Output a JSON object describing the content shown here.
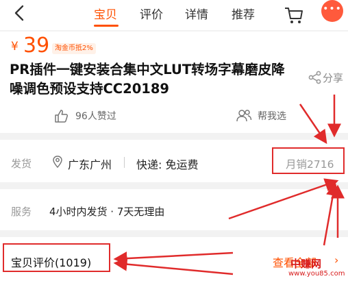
{
  "nav": {
    "tabs": [
      {
        "label": "宝贝",
        "active": true
      },
      {
        "label": "评价",
        "active": false
      },
      {
        "label": "详情",
        "active": false
      },
      {
        "label": "推荐",
        "active": false
      }
    ],
    "more_label": "•••",
    "icons": [
      "back-icon",
      "cart-icon"
    ]
  },
  "product": {
    "currency": "¥",
    "price": "39",
    "coin_badge": "淘金币抵2%",
    "title": "PR插件一键安装合集中文LUT转场字幕磨皮降噪调色预设支持CC20189",
    "share_label": "分享",
    "likes": "96人赞过",
    "help_choose": "帮我选"
  },
  "shipping": {
    "label": "发货",
    "location": "广东广州",
    "delivery": "快递: 免运费",
    "monthly_sales": "月销2716"
  },
  "service": {
    "label": "服务",
    "text": "4小时内发货 · 7天无理由"
  },
  "reviews": {
    "title": "宝贝评价(1019)",
    "view_all": "查看全部",
    "arrow": "›"
  },
  "watermark": {
    "main": "中赚网",
    "sub": "www.you85.com"
  },
  "colors": {
    "accent": "#ff5000",
    "annotation_red": "#e02b2b",
    "muted": "#999999"
  }
}
